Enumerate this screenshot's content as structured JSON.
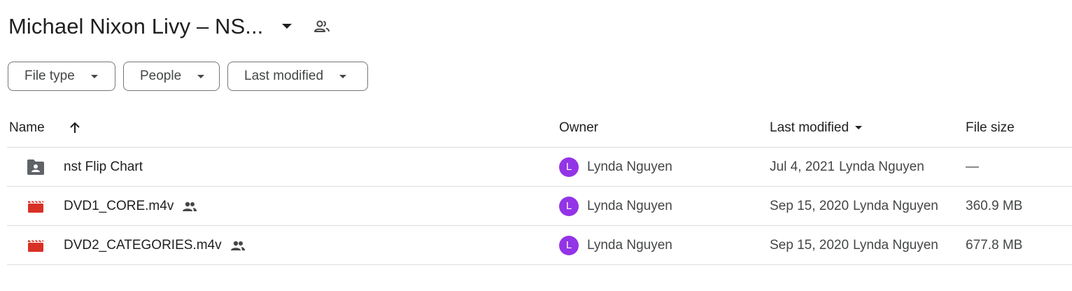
{
  "header": {
    "title": "Michael Nixon Livy – NS...",
    "caret_icon": "arrow-drop-down-icon",
    "shared_icon": "people-icon"
  },
  "filters": [
    {
      "label": "File type"
    },
    {
      "label": "People"
    },
    {
      "label": "Last modified"
    }
  ],
  "columns": {
    "name": "Name",
    "owner": "Owner",
    "last_modified": "Last modified",
    "file_size": "File size",
    "sort_icon": "arrow-upward-icon",
    "modified_sort_icon": "arrow-drop-down-icon"
  },
  "rows": [
    {
      "name": "nst Flip Chart",
      "icon": "shared-folder-icon",
      "shared": false,
      "owner_initial": "L",
      "owner": "Lynda Nguyen",
      "modified_date": "Jul 4, 2021",
      "modified_by": "Lynda Nguyen",
      "size": "—"
    },
    {
      "name": "DVD1_CORE.m4v",
      "icon": "video-file-icon",
      "shared": true,
      "owner_initial": "L",
      "owner": "Lynda Nguyen",
      "modified_date": "Sep 15, 2020",
      "modified_by": "Lynda Nguyen",
      "size": "360.9 MB"
    },
    {
      "name": "DVD2_CATEGORIES.m4v",
      "icon": "video-file-icon",
      "shared": true,
      "owner_initial": "L",
      "owner": "Lynda Nguyen",
      "modified_date": "Sep 15, 2020",
      "modified_by": "Lynda Nguyen",
      "size": "677.8 MB"
    }
  ],
  "colors": {
    "avatar": "#9334e6",
    "video_icon": "#d93025",
    "folder_icon": "#5f6368",
    "divider": "#dadce0"
  }
}
